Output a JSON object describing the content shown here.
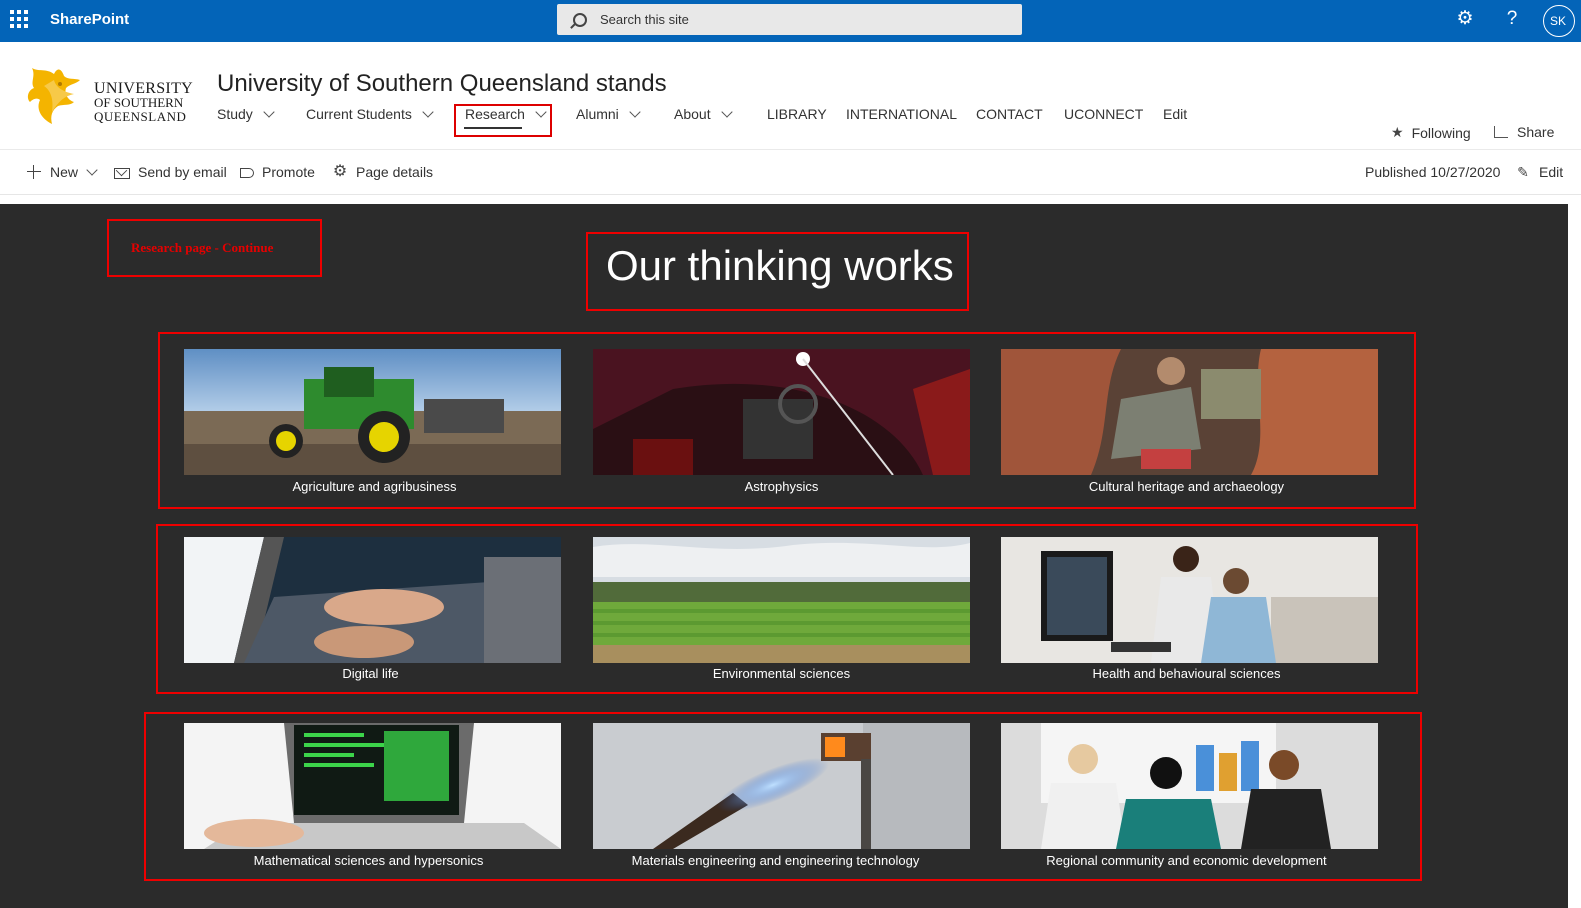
{
  "suitebar": {
    "brand": "SharePoint",
    "search_placeholder": "Search this site",
    "icons": [
      "waffle-icon",
      "search-icon",
      "gear-icon",
      "help-icon"
    ],
    "help_glyph": "?",
    "avatar": "SK",
    "bg_color": "#0364b8"
  },
  "header": {
    "logo_lines": [
      "UNIVERSITY",
      "OF SOUTHERN",
      "QUEENSLAND"
    ],
    "site_title": "University of Southern Queensland stands",
    "nav": [
      {
        "label": "Study",
        "dropdown": true
      },
      {
        "label": "Current Students",
        "dropdown": true
      },
      {
        "label": "Research",
        "dropdown": true,
        "active": true
      },
      {
        "label": "Alumni",
        "dropdown": true
      },
      {
        "label": "About",
        "dropdown": true
      },
      {
        "label": "LIBRARY",
        "dropdown": false
      },
      {
        "label": "INTERNATIONAL",
        "dropdown": false
      },
      {
        "label": "CONTACT",
        "dropdown": false
      },
      {
        "label": "UCONNECT",
        "dropdown": false
      },
      {
        "label": "Edit",
        "dropdown": false
      }
    ],
    "following": "Following",
    "share": "Share"
  },
  "commandbar": {
    "new": "New",
    "send_by_email": "Send by email",
    "promote": "Promote",
    "page_details": "Page details",
    "published": "Published 10/27/2020",
    "edit": "Edit"
  },
  "main": {
    "bg_color": "#2b2b2b",
    "annotation": "Research page - Continue",
    "hero_title": "Our thinking works",
    "annotation_color": "#e00000",
    "tiles": [
      {
        "caption": "Agriculture and agribusiness",
        "image": "tractor-image"
      },
      {
        "caption": "Astrophysics",
        "image": "telescope-image"
      },
      {
        "caption": "Cultural heritage and archaeology",
        "image": "archaeology-image"
      },
      {
        "caption": "Digital life",
        "image": "laptop-typing-image"
      },
      {
        "caption": "Environmental sciences",
        "image": "field-image"
      },
      {
        "caption": "Health and behavioural sciences",
        "image": "health-lab-image"
      },
      {
        "caption": "Mathematical sciences and hypersonics",
        "image": "code-laptop-image"
      },
      {
        "caption": "Materials engineering and engineering technology",
        "image": "torch-image"
      },
      {
        "caption": "Regional community and economic development",
        "image": "meeting-image"
      }
    ]
  }
}
